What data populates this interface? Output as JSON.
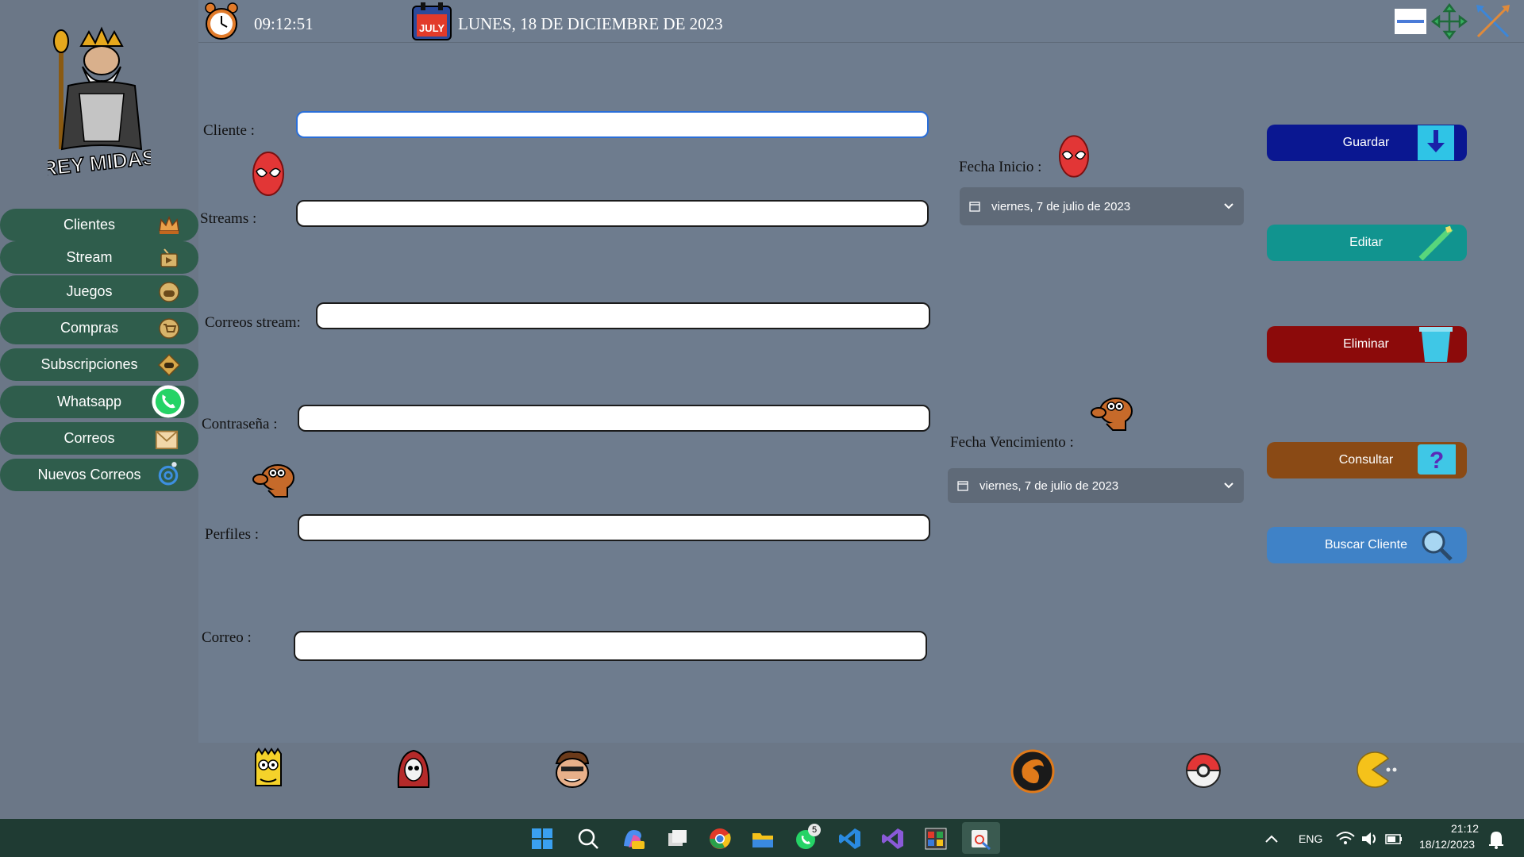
{
  "header": {
    "time": "09:12:51",
    "date": "LUNES, 18 DE DICIEMBRE DE 2023",
    "calendar_badge": "JULY"
  },
  "sidebar": {
    "logo_text": "REY MIDAS",
    "items": [
      {
        "label": "Clientes",
        "icon": "crown-icon"
      },
      {
        "label": "Stream",
        "icon": "tv-icon"
      },
      {
        "label": "Juegos",
        "icon": "gamepad-icon"
      },
      {
        "label": "Compras",
        "icon": "cart-icon"
      },
      {
        "label": "Subscripciones",
        "icon": "subscription-icon"
      },
      {
        "label": "Whatsapp",
        "icon": "whatsapp-icon"
      },
      {
        "label": "Correos",
        "icon": "envelope-icon"
      },
      {
        "label": "Nuevos Correos",
        "icon": "at-sign-icon"
      }
    ]
  },
  "form": {
    "cliente_label": "Cliente :",
    "cliente_value": "",
    "streams_label": "Streams :",
    "streams_value": "",
    "correos_stream_label": "Correos stream:",
    "correos_stream_value": "",
    "contrasena_label": "Contraseña :",
    "contrasena_value": "",
    "perfiles_label": "Perfiles :",
    "perfiles_value": "",
    "correo_label": "Correo :",
    "correo_value": "",
    "fecha_inicio_label": "Fecha Inicio :",
    "fecha_inicio_value": "viernes, 7 de julio de 2023",
    "fecha_vencimiento_label": "Fecha Vencimiento :",
    "fecha_vencimiento_value": "viernes, 7 de julio de 2023"
  },
  "actions": {
    "guardar": "Guardar",
    "editar": "Editar",
    "eliminar": "Eliminar",
    "consultar": "Consultar",
    "buscar_cliente": "Buscar Cliente"
  },
  "colors": {
    "guardar": "#0a1791",
    "editar": "#11948f",
    "eliminar": "#8c0a0a",
    "consultar": "#8a4a15",
    "buscar_cliente": "#3f82c7",
    "sidebar_item": "#2f5d4c",
    "background": "#6e7c8e"
  },
  "taskbar": {
    "whatsapp_badge": "5",
    "language": "ENG",
    "clock_time": "21:12",
    "clock_date": "18/12/2023"
  }
}
